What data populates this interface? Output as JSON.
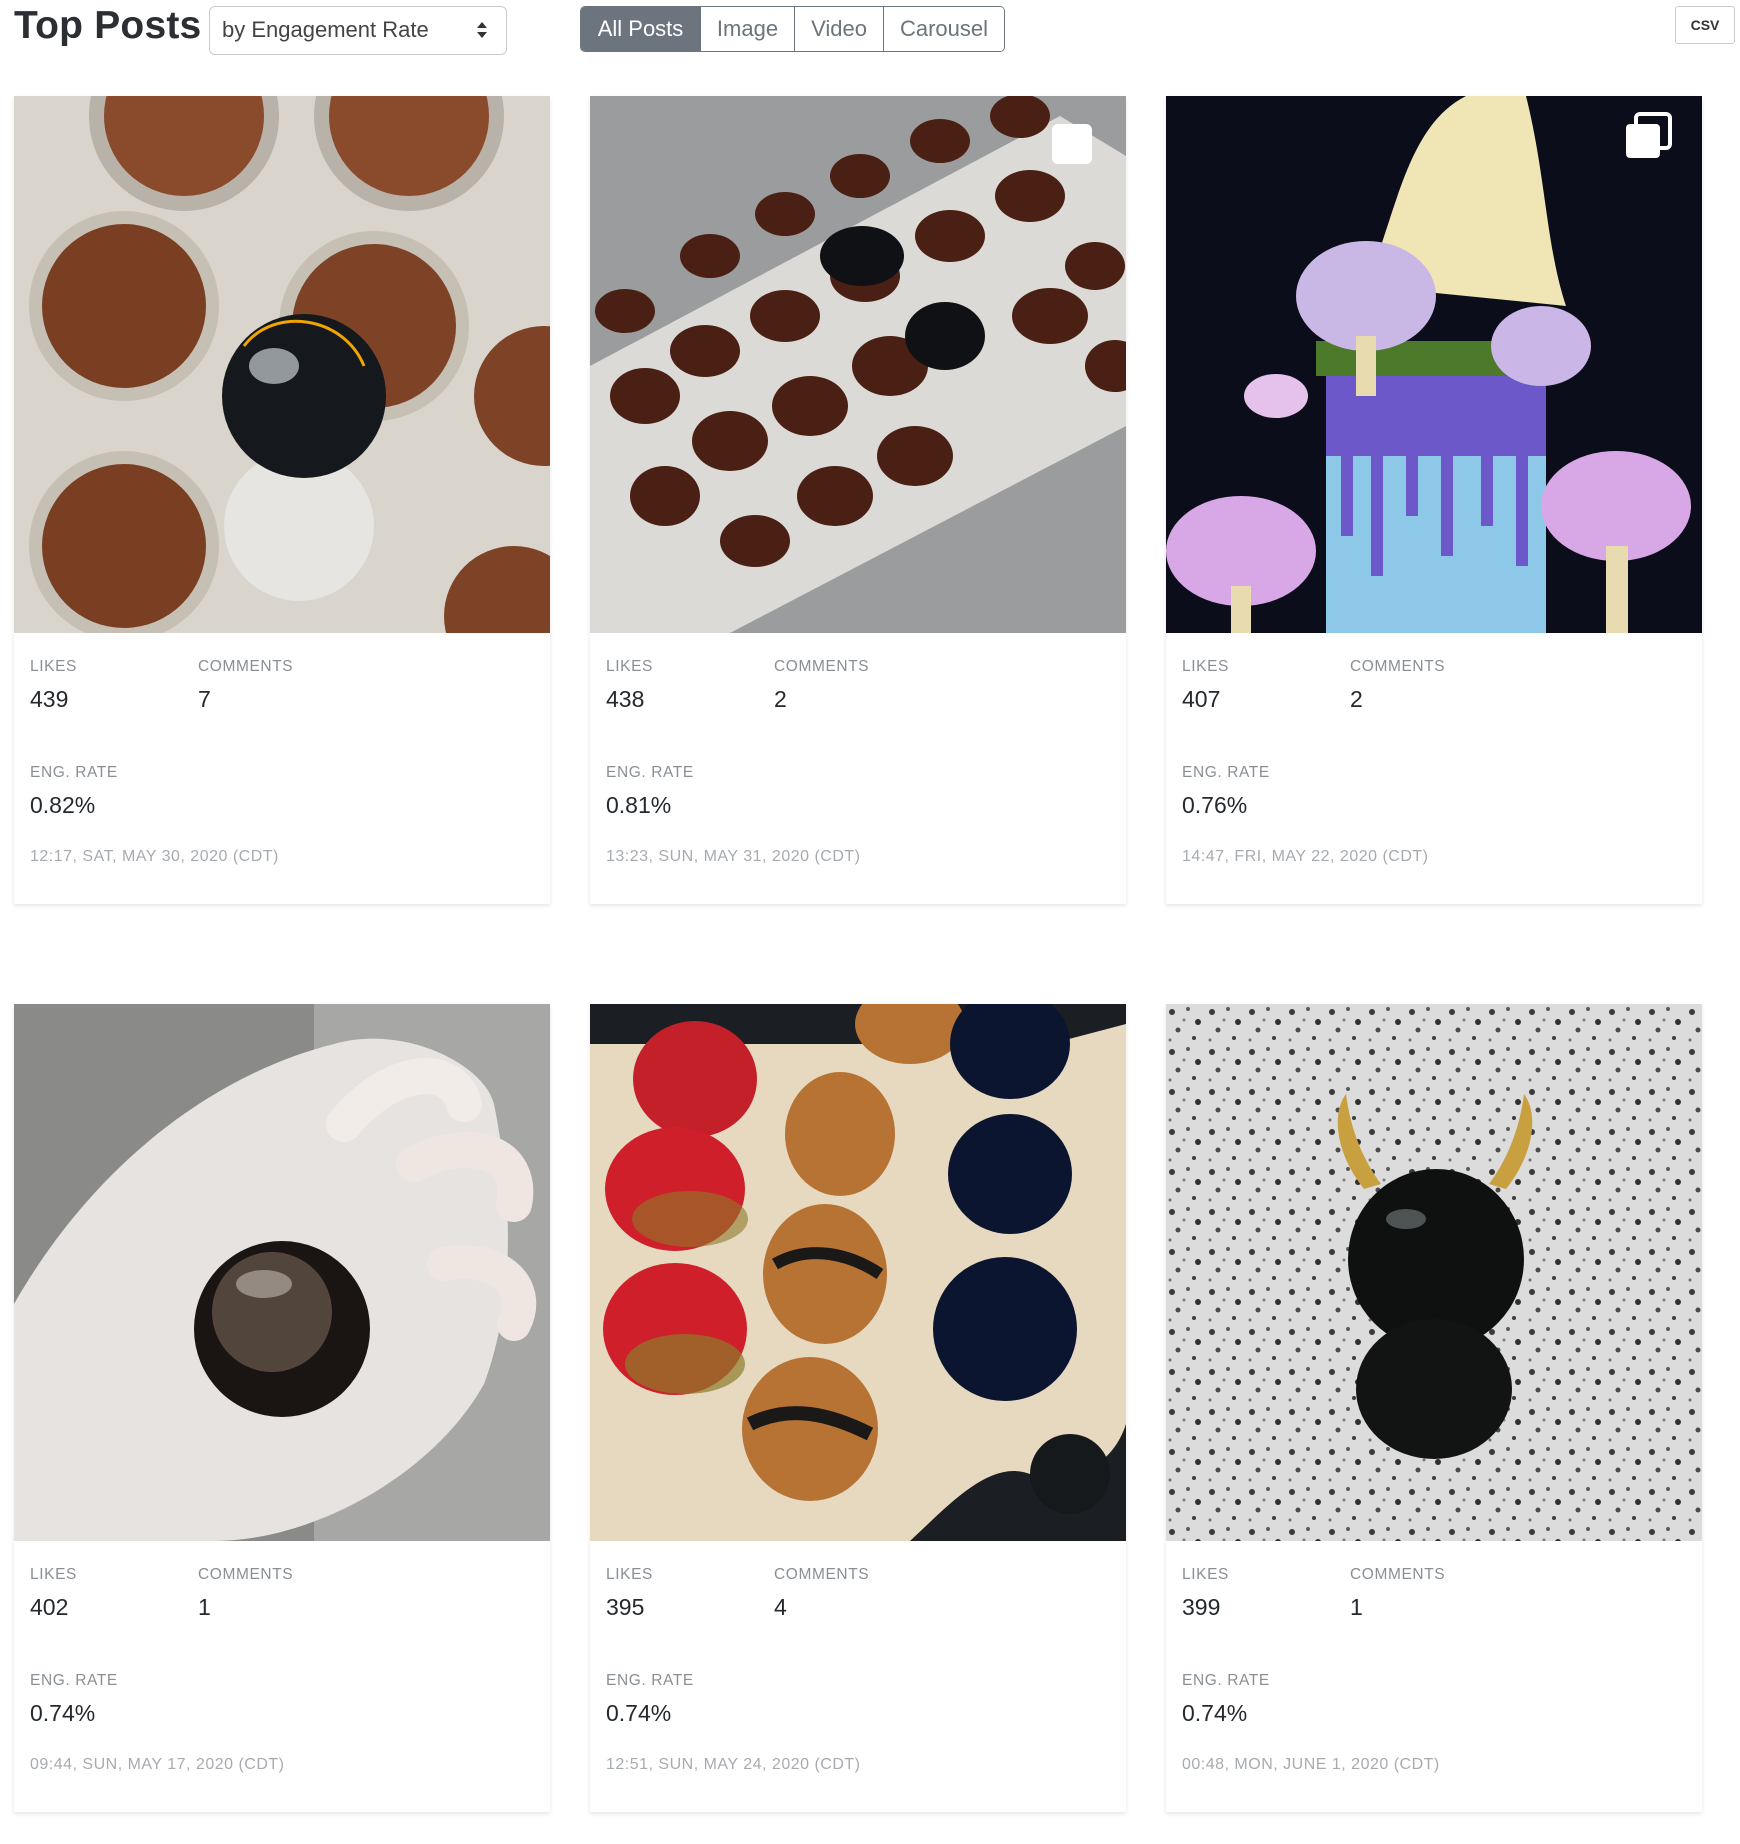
{
  "header": {
    "title": "Top Posts",
    "sort_label": "by Engagement Rate",
    "filters": [
      "All Posts",
      "Image",
      "Video",
      "Carousel"
    ],
    "active_filter": "All Posts",
    "csv_label": "CSV"
  },
  "labels": {
    "likes": "LIKES",
    "comments": "COMMENTS",
    "eng_rate": "ENG. RATE"
  },
  "posts": [
    {
      "likes": "439",
      "comments": "7",
      "eng_rate": "0.82%",
      "timestamp": "12:17, SAT, MAY 30, 2020 (CDT)",
      "carousel": false
    },
    {
      "likes": "438",
      "comments": "2",
      "eng_rate": "0.81%",
      "timestamp": "13:23, SUN, MAY 31, 2020 (CDT)",
      "carousel": true
    },
    {
      "likes": "407",
      "comments": "2",
      "eng_rate": "0.76%",
      "timestamp": "14:47, FRI, MAY 22, 2020 (CDT)",
      "carousel": true
    },
    {
      "likes": "402",
      "comments": "1",
      "eng_rate": "0.74%",
      "timestamp": "09:44, SUN, MAY 17, 2020 (CDT)",
      "carousel": false
    },
    {
      "likes": "395",
      "comments": "4",
      "eng_rate": "0.74%",
      "timestamp": "12:51, SUN, MAY 24, 2020 (CDT)",
      "carousel": false
    },
    {
      "likes": "399",
      "comments": "1",
      "eng_rate": "0.74%",
      "timestamp": "00:48, MON, JUNE 1, 2020 (CDT)",
      "carousel": false
    }
  ],
  "colors": {
    "accent": "#6c757d",
    "label": "#8a8f94",
    "timestamp": "#a7abaf"
  }
}
